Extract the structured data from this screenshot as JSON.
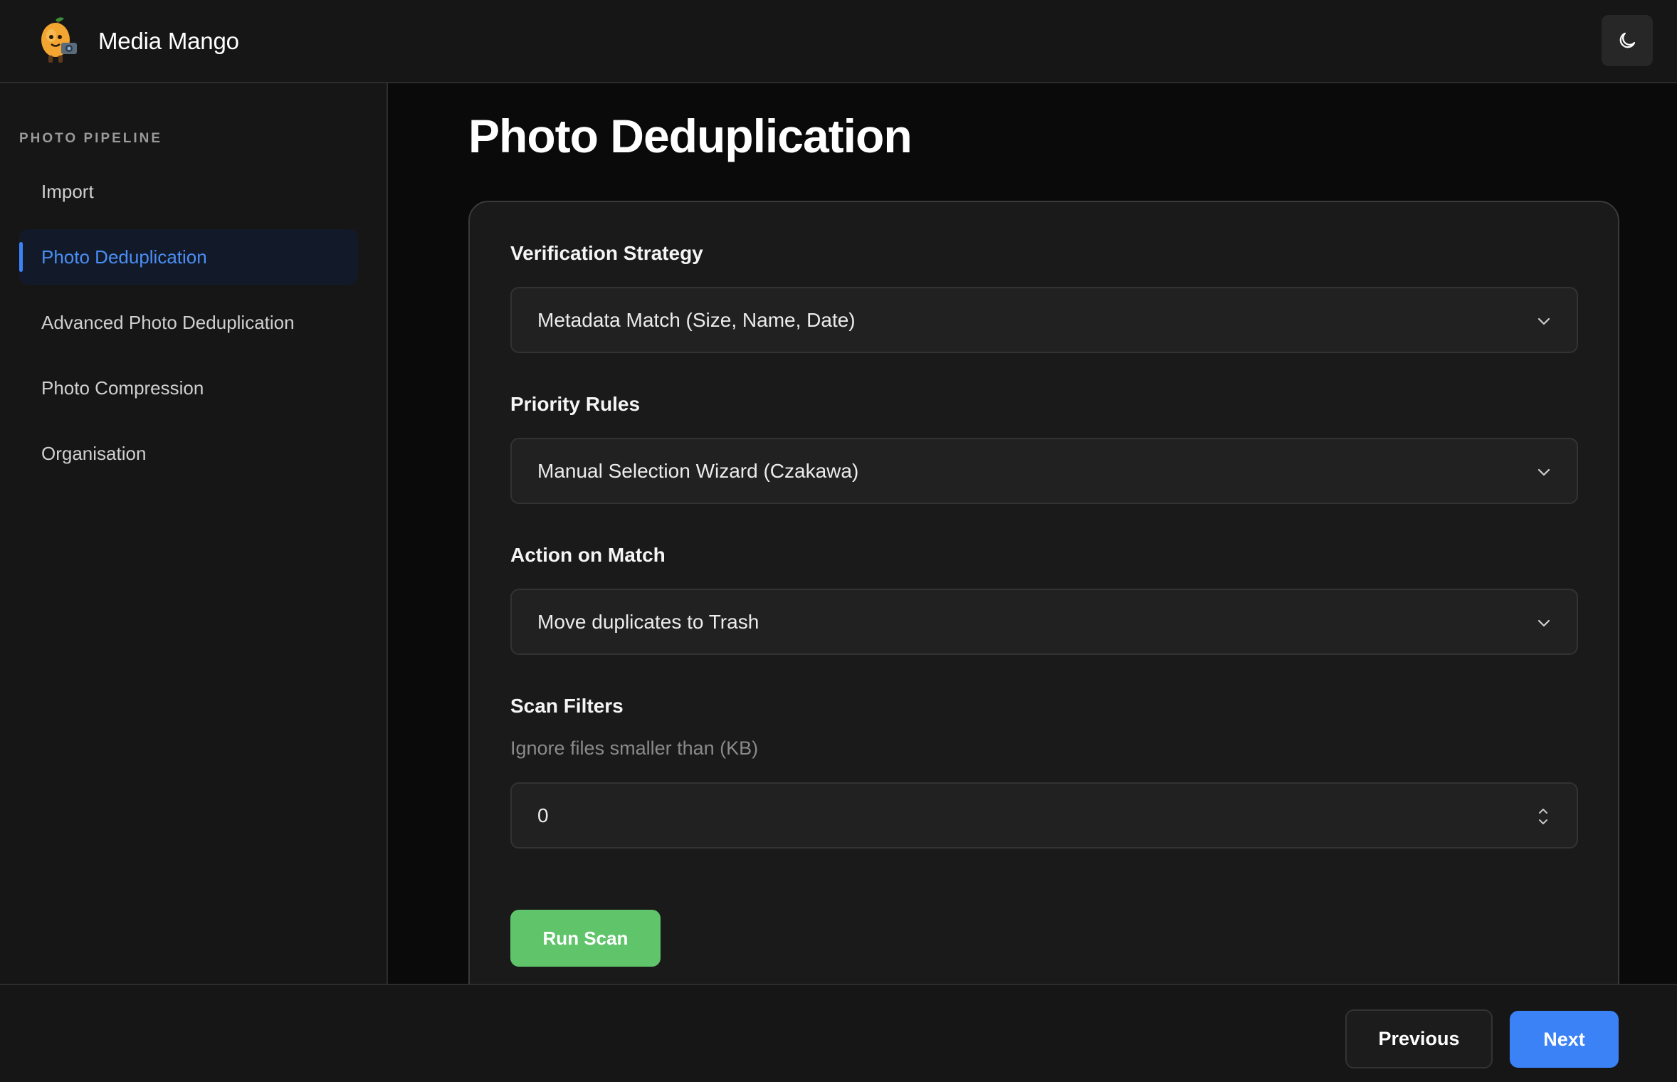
{
  "app": {
    "brand": "Media Mango",
    "logo_icon": "mango-mascot-icon",
    "theme_toggle_icon": "moon-icon"
  },
  "sidebar": {
    "section_title": "PHOTO PIPELINE",
    "items": [
      {
        "label": "Import",
        "active": false
      },
      {
        "label": "Photo Deduplication",
        "active": true
      },
      {
        "label": "Advanced Photo Deduplication",
        "active": false
      },
      {
        "label": "Photo Compression",
        "active": false
      },
      {
        "label": "Organisation",
        "active": false
      }
    ]
  },
  "main": {
    "title": "Photo Deduplication",
    "verification": {
      "label": "Verification Strategy",
      "value": "Metadata Match (Size, Name, Date)"
    },
    "priority": {
      "label": "Priority Rules",
      "value": "Manual Selection Wizard (Czakawa)"
    },
    "action": {
      "label": "Action on Match",
      "value": "Move duplicates to Trash"
    },
    "filters": {
      "label": "Scan Filters",
      "min_size_label": "Ignore files smaller than (KB)",
      "min_size_value": "0"
    },
    "run_button": "Run Scan"
  },
  "footer": {
    "previous": "Previous",
    "next": "Next"
  },
  "colors": {
    "accent": "#3b82f6",
    "success": "#5fc46a",
    "background": "#0a0a0a",
    "panel": "#161616"
  }
}
